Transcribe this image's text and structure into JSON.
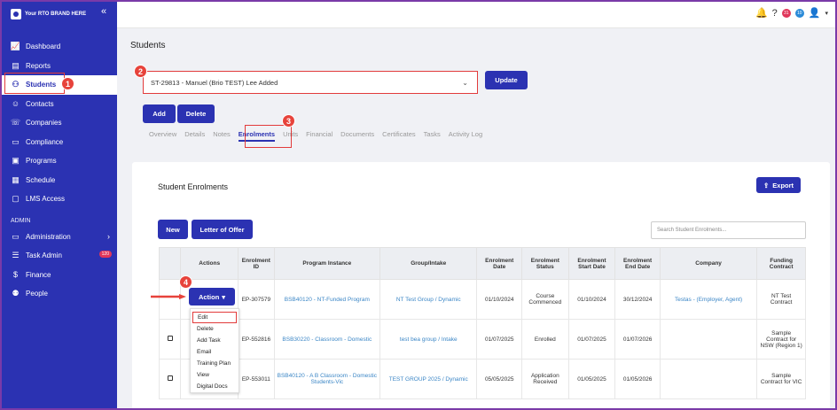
{
  "brand": "Your RTO BRAND HERE",
  "sidebar": {
    "items": [
      {
        "label": "Dashboard",
        "icon": "chart-icon"
      },
      {
        "label": "Reports",
        "icon": "report-icon"
      },
      {
        "label": "Students",
        "icon": "students-icon"
      },
      {
        "label": "Contacts",
        "icon": "contacts-icon"
      },
      {
        "label": "Companies",
        "icon": "companies-icon"
      },
      {
        "label": "Compliance",
        "icon": "compliance-icon"
      },
      {
        "label": "Programs",
        "icon": "programs-icon"
      },
      {
        "label": "Schedule",
        "icon": "schedule-icon"
      },
      {
        "label": "LMS Access",
        "icon": "lms-icon"
      }
    ],
    "admin_label": "ADMIN",
    "admin_items": [
      {
        "label": "Administration"
      },
      {
        "label": "Task Admin",
        "badge": "120"
      },
      {
        "label": "Finance"
      },
      {
        "label": "People"
      }
    ]
  },
  "topbar": {
    "badge1": "31",
    "badge2": "10"
  },
  "page_title": "Students",
  "student_select": "ST-29813 - Manuel (Brio TEST) Lee Added",
  "buttons": {
    "update": "Update",
    "add": "Add",
    "delete": "Delete",
    "new": "New",
    "letter": "Letter of Offer",
    "export": "Export",
    "action": "Action"
  },
  "tabs": [
    "Overview",
    "Details",
    "Notes",
    "Enrolments",
    "Units",
    "Financial",
    "Documents",
    "Certificates",
    "Tasks",
    "Activity Log"
  ],
  "section_title": "Student Enrolments",
  "search_placeholder": "Search Student Enrolments...",
  "table": {
    "headers": [
      "",
      "Actions",
      "Enrolment ID",
      "Program Instance",
      "Group/Intake",
      "Enrolment Date",
      "Enrolment Status",
      "Enrolment Start Date",
      "Enrolment End Date",
      "Company",
      "Funding Contract"
    ],
    "rows": [
      {
        "id": "EP-307579",
        "program": "BSB40120 - NT-Funded Program",
        "group": "NT Test Group / Dynamic",
        "date": "01/10/2024",
        "status": "Course Commenced",
        "start": "01/10/2024",
        "end": "30/12/2024",
        "company": "Testas - (Employer, Agent)",
        "funding": "NT Test Contract"
      },
      {
        "id": "EP-552816",
        "program": "BSB30220 - Classroom - Domestic",
        "group": "test bea group / Intake",
        "date": "01/07/2025",
        "status": "Enrolled",
        "start": "01/07/2025",
        "end": "01/07/2026",
        "company": "",
        "funding": "Sample Contract for NSW (Region 1)"
      },
      {
        "id": "EP-553011",
        "program": "BSB40120 - A B Classroom - Domestic Students-Vic",
        "group": "TEST GROUP 2025 / Dynamic",
        "date": "05/05/2025",
        "status": "Application Received",
        "start": "01/05/2025",
        "end": "01/05/2026",
        "company": "",
        "funding": "Sample Contract for VIC"
      }
    ]
  },
  "dropdown": [
    "Edit",
    "Delete",
    "Add Task",
    "Email",
    "Training Plan",
    "View",
    "Digital Docs"
  ],
  "steps": [
    "1",
    "2",
    "3",
    "4"
  ]
}
